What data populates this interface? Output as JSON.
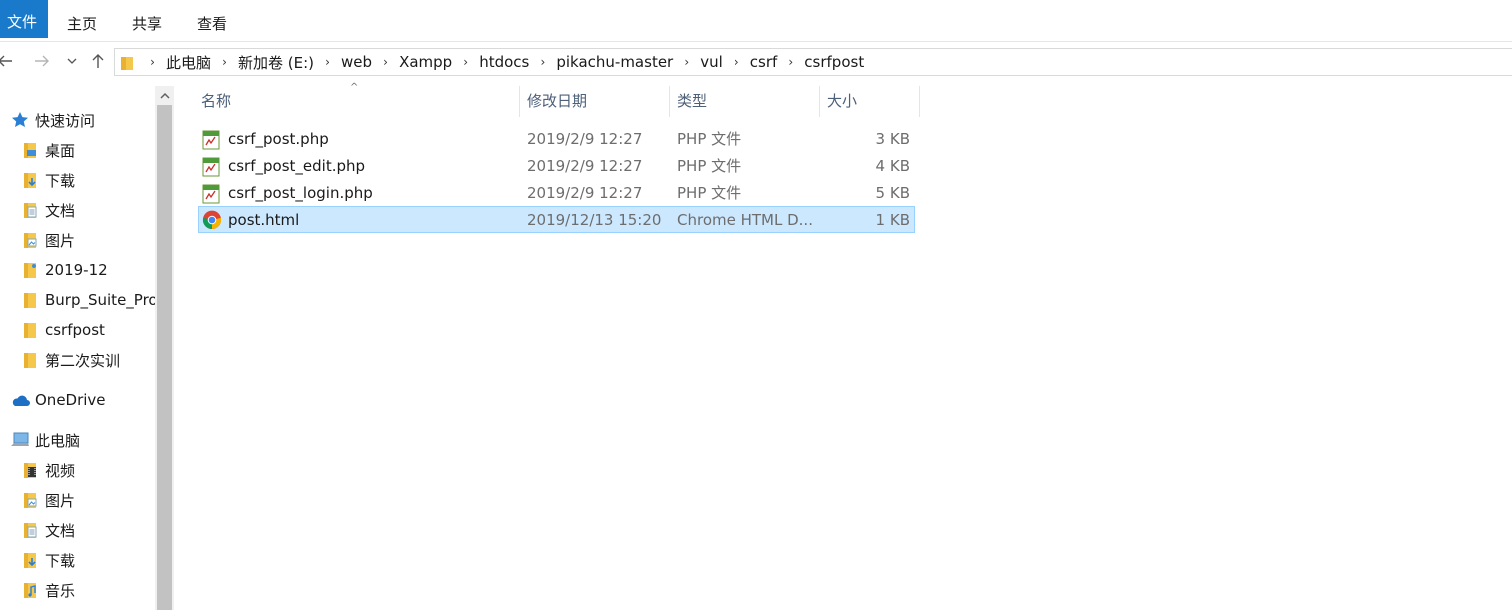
{
  "ribbon": {
    "file_tab": "文件",
    "tabs": [
      "主页",
      "共享",
      "查看"
    ]
  },
  "address": {
    "crumbs": [
      "此电脑",
      "新加卷 (E:)",
      "web",
      "Xampp",
      "htdocs",
      "pikachu-master",
      "vul",
      "csrf",
      "csrfpost"
    ]
  },
  "sidebar": {
    "quick_access": "快速访问",
    "quick_items": [
      {
        "label": "桌面",
        "pinned": true
      },
      {
        "label": "下载",
        "pinned": true
      },
      {
        "label": "文档",
        "pinned": true
      },
      {
        "label": "图片",
        "pinned": true
      },
      {
        "label": "2019-12",
        "pinned": false
      },
      {
        "label": "Burp_Suite_Pro",
        "pinned": false
      },
      {
        "label": "csrfpost",
        "pinned": false
      },
      {
        "label": "第二次实训",
        "pinned": false
      }
    ],
    "onedrive": "OneDrive",
    "this_pc": "此电脑",
    "pc_items": [
      "视频",
      "图片",
      "文档",
      "下载",
      "音乐"
    ]
  },
  "columns": {
    "name": "名称",
    "date": "修改日期",
    "type": "类型",
    "size": "大小"
  },
  "files": [
    {
      "name": "csrf_post.php",
      "date": "2019/2/9 12:27",
      "type": "PHP 文件",
      "size": "3 KB",
      "icon": "php-file-icon",
      "selected": false
    },
    {
      "name": "csrf_post_edit.php",
      "date": "2019/2/9 12:27",
      "type": "PHP 文件",
      "size": "4 KB",
      "icon": "php-file-icon",
      "selected": false
    },
    {
      "name": "csrf_post_login.php",
      "date": "2019/2/9 12:27",
      "type": "PHP 文件",
      "size": "5 KB",
      "icon": "php-file-icon",
      "selected": false
    },
    {
      "name": "post.html",
      "date": "2019/12/13 15:20",
      "type": "Chrome HTML D...",
      "size": "1 KB",
      "icon": "chrome-icon",
      "selected": true
    }
  ],
  "colors": {
    "accent": "#1979ca",
    "selection": "#cce8ff",
    "selection_border": "#99d1ff",
    "header_text": "#4c607a",
    "folder": "#f5c84c"
  }
}
